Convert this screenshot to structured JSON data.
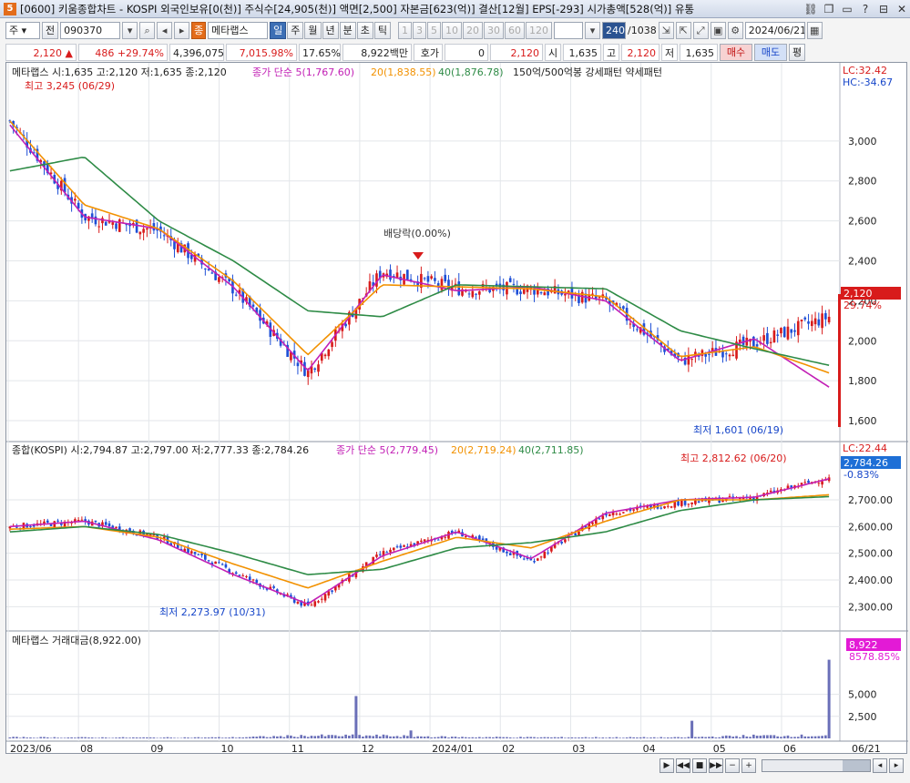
{
  "window": {
    "app_number": "5",
    "title": "[0600] 키움종합차트 - KOSPI 외국인보유[0(천)] 주식수[24,905(천)] 액면[2,500] 자본금[623(억)] 결산[12월] EPS[-293] 시가총액[528(억)] 유통"
  },
  "toolbar": {
    "market_select": "주",
    "prev_label": "전",
    "stock_code": "090370",
    "stock_name_badge": "종",
    "stock_name": "메타랩스",
    "period_tabs": [
      "일",
      "주",
      "월",
      "년",
      "분",
      "초",
      "틱"
    ],
    "period_selected": "일",
    "interval_buttons": [
      "1",
      "3",
      "5",
      "10",
      "20",
      "30",
      "60",
      "120"
    ],
    "count_value": "240",
    "count_total": "/1038",
    "date_value": "2024/06/21"
  },
  "quote": {
    "price": "2,120",
    "change": "486",
    "change_pct": "+29.74%",
    "volume": "4,396,075",
    "volume_ratio": "7,015.98%",
    "turnover": "17.65%",
    "amount": "8,922백만",
    "bid_label": "호가",
    "bid_value": "0",
    "ask_price": "2,120",
    "open_label": "시",
    "open_value": "1,635",
    "high_label": "고",
    "high_value": "2,120",
    "low_label": "저",
    "low_value": "1,635",
    "buy_label": "매수",
    "sell_label": "매도",
    "eval_label": "평"
  },
  "price_panel": {
    "legend_title": "메타랩스 시:1,635 고:2,120 저:1,635 종:2,120",
    "ma_label": "종가 단순",
    "ma5": "5(1,767.60)",
    "ma20": "20(1,838.55)",
    "ma40": "40(1,876.78)",
    "pattern_label": "150억/500억봉 강세패턴 약세패턴",
    "lc_label": "LC:32.42",
    "hc_label": "HC:-34.67",
    "max_label": "최고 3,245 (06/29)",
    "min_label": "최저 1,601 (06/19)",
    "dividend_label": "배당락(0.00%)",
    "current_tag": "2,120",
    "current_pct": "29.74%",
    "y_ticks": [
      "3,000",
      "2,800",
      "2,600",
      "2,400",
      "2,200",
      "2,000",
      "1,800",
      "1,600"
    ]
  },
  "index_panel": {
    "legend_title": "종합(KOSPI) 시:2,794.87 고:2,797.00 저:2,777.33 종:2,784.26",
    "ma_label": "종가 단순",
    "ma5": "5(2,779.45)",
    "ma20": "20(2,719.24)",
    "ma40": "40(2,711.85)",
    "lc_label": "LC:22.44",
    "current_tag": "2,784.26",
    "current_pct": "-0.83%",
    "max_label": "최고 2,812.62 (06/20)",
    "min_label": "최저 2,273.97 (10/31)",
    "y_ticks": [
      "2,700.00",
      "2,600.00",
      "2,500.00",
      "2,400.00",
      "2,300.00"
    ]
  },
  "volume_panel": {
    "legend_title": "메타랩스 거래대금(8,922.00)",
    "current_tag": "8,922",
    "current_pct": "8578.85%",
    "y_ticks": [
      "5,000",
      "2,500"
    ]
  },
  "x_axis": {
    "labels": [
      "2023/06",
      "08",
      "09",
      "10",
      "11",
      "12",
      "2024/01",
      "02",
      "03",
      "04",
      "05",
      "06"
    ],
    "right_label": "06/21"
  },
  "colors": {
    "up": "#d81b1b",
    "down": "#1e4fd6",
    "ma5": "#c21fb5",
    "ma20": "#f29100",
    "ma40": "#2e8b46"
  },
  "chart_data": [
    {
      "type": "candlestick",
      "title": "메타랩스",
      "ylim": [
        1550,
        3300
      ],
      "x": [
        "2023/06",
        "08",
        "09",
        "10",
        "11",
        "12",
        "2024/01",
        "02",
        "03",
        "04",
        "05",
        "06"
      ],
      "close_trend": [
        3100,
        2620,
        2550,
        2260,
        1840,
        2350,
        2260,
        2260,
        2200,
        1900,
        1990,
        2120
      ],
      "series": [
        {
          "name": "5",
          "values": [
            3080,
            2620,
            2560,
            2270,
            1850,
            2330,
            2250,
            2270,
            2200,
            1900,
            2010,
            1768
          ]
        },
        {
          "name": "20",
          "values": [
            3100,
            2680,
            2560,
            2300,
            1930,
            2280,
            2270,
            2260,
            2220,
            1920,
            1970,
            1839
          ]
        },
        {
          "name": "40",
          "values": [
            2850,
            2920,
            2600,
            2400,
            2150,
            2120,
            2280,
            2270,
            2260,
            2050,
            1960,
            1877
          ]
        }
      ]
    },
    {
      "type": "candlestick",
      "title": "종합(KOSPI)",
      "ylim": [
        2250,
        2850
      ],
      "x": [
        "2023/06",
        "08",
        "09",
        "10",
        "11",
        "12",
        "2024/01",
        "02",
        "03",
        "04",
        "05",
        "06"
      ],
      "close_trend": [
        2600,
        2620,
        2560,
        2430,
        2300,
        2500,
        2580,
        2470,
        2650,
        2690,
        2710,
        2784
      ],
      "series": [
        {
          "name": "5",
          "values": [
            2600,
            2620,
            2550,
            2420,
            2310,
            2490,
            2580,
            2480,
            2650,
            2700,
            2710,
            2779
          ]
        },
        {
          "name": "20",
          "values": [
            2590,
            2600,
            2560,
            2460,
            2370,
            2470,
            2560,
            2520,
            2620,
            2700,
            2700,
            2719
          ]
        },
        {
          "name": "40",
          "values": [
            2580,
            2600,
            2570,
            2500,
            2420,
            2440,
            2520,
            2540,
            2580,
            2660,
            2700,
            2712
          ]
        }
      ]
    },
    {
      "type": "bar",
      "title": "메타랩스 거래대금",
      "ylim": [
        0,
        9500
      ],
      "x": [
        "2023/06",
        "08",
        "09",
        "10",
        "11",
        "12",
        "2024/01",
        "02",
        "03",
        "04",
        "05",
        "06"
      ],
      "values": [
        120,
        100,
        90,
        110,
        4800,
        900,
        150,
        120,
        110,
        100,
        2000,
        8922
      ]
    }
  ]
}
